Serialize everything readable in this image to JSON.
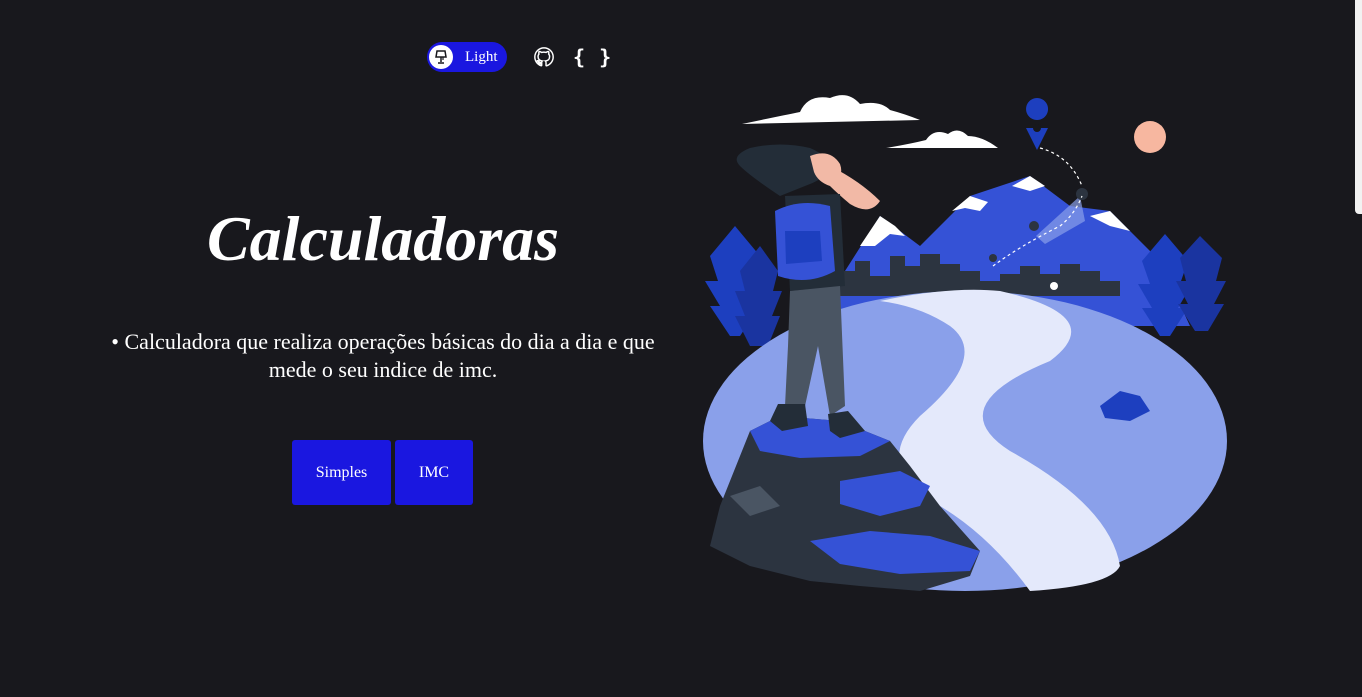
{
  "header": {
    "theme_toggle_label": "Light",
    "code_link_label": "{ }"
  },
  "hero": {
    "title": "Calculadoras",
    "description": "• Calculadora que realiza operações básicas do dia a dia e que mede o seu indice de imc."
  },
  "buttons": {
    "simples": "Simples",
    "imc": "IMC"
  },
  "colors": {
    "background": "#18181d",
    "accent": "#1a17e0",
    "illustration_blue": "#3552d6",
    "illustration_light_blue": "#8aa0ea",
    "illustration_pale": "#e4e9fb",
    "sun": "#f7b7a0"
  },
  "icons": {
    "theme": "lamp-icon",
    "github": "github-icon",
    "code": "code-braces-icon"
  }
}
